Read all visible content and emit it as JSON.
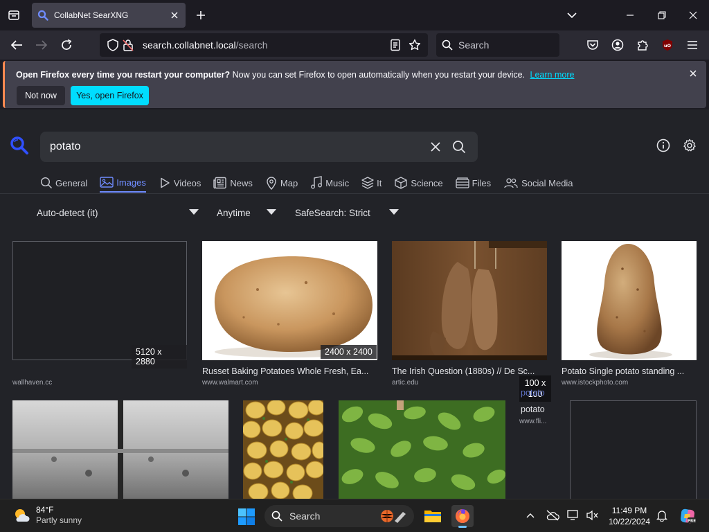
{
  "browser": {
    "tab": {
      "title": "CollabNet SearXNG"
    },
    "url": {
      "host": "search.collabnet.local",
      "path": "/search"
    },
    "web_search": {
      "placeholder": "Search"
    }
  },
  "notification": {
    "bold": "Open Firefox every time you restart your computer?",
    "text": " Now you can set Firefox to open automatically when you restart your device.",
    "link": "Learn more",
    "not_now": "Not now",
    "yes": "Yes, open Firefox"
  },
  "search": {
    "query": "potato"
  },
  "categories": [
    {
      "label": "General",
      "icon": "search-icon"
    },
    {
      "label": "Images",
      "icon": "image-icon"
    },
    {
      "label": "Videos",
      "icon": "play-icon"
    },
    {
      "label": "News",
      "icon": "newspaper-icon"
    },
    {
      "label": "Map",
      "icon": "map-pin-icon"
    },
    {
      "label": "Music",
      "icon": "music-note-icon"
    },
    {
      "label": "It",
      "icon": "layers-icon"
    },
    {
      "label": "Science",
      "icon": "cube-icon"
    },
    {
      "label": "Files",
      "icon": "files-icon"
    },
    {
      "label": "Social Media",
      "icon": "people-icon"
    }
  ],
  "active_category": "Images",
  "filters": {
    "language": "Auto-detect (it)",
    "time": "Anytime",
    "safesearch": "SafeSearch: Strict"
  },
  "results": [
    {
      "resolution": "5120 x 2880",
      "title": "",
      "url": "wallhaven.cc"
    },
    {
      "resolution": "2400 x 2400",
      "title": "Russet Baking Potatoes Whole Fresh, Ea...",
      "url": "www.walmart.com"
    },
    {
      "resolution": "",
      "title": "The Irish Question (1880s) // De Sc...",
      "url": "artic.edu"
    },
    {
      "resolution": "",
      "title": "Potato Single potato standing ...",
      "url": "www.istockphoto.com"
    },
    {
      "resolution": "100 x 100",
      "alt": "potato",
      "title": "potato",
      "url": "www.fli..."
    }
  ],
  "taskbar": {
    "weather": {
      "temp": "84°F",
      "condition": "Partly sunny"
    },
    "search_placeholder": "Search",
    "time": "11:49 PM",
    "date": "10/22/2024"
  },
  "colors": {
    "accent": "#6f8cff",
    "firefox_cyan": "#00ddff",
    "page_bg": "#222328",
    "notif_accent": "#ff8a50"
  }
}
